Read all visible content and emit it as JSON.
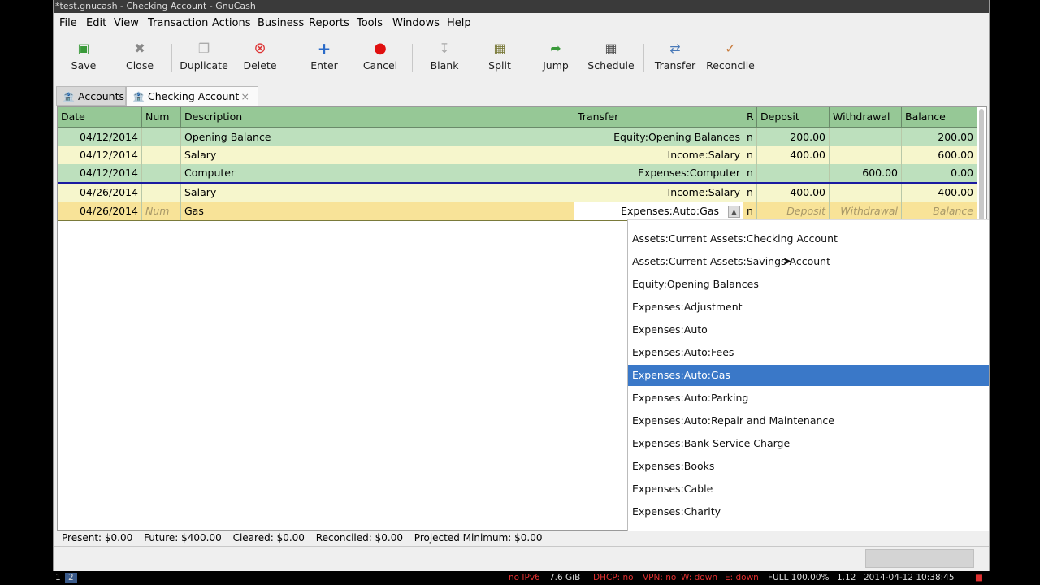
{
  "window": {
    "title": "*test.gnucash - Checking Account - GnuCash"
  },
  "menu": [
    "File",
    "Edit",
    "View",
    "Transaction",
    "Actions",
    "Business",
    "Reports",
    "Tools",
    "Windows",
    "Help"
  ],
  "toolbar": [
    {
      "label": "Save",
      "icon": "save-icon"
    },
    {
      "label": "Close",
      "icon": "close-icon"
    },
    {
      "label": "Duplicate",
      "icon": "duplicate-icon"
    },
    {
      "label": "Delete",
      "icon": "delete-icon"
    },
    {
      "label": "Enter",
      "icon": "enter-icon"
    },
    {
      "label": "Cancel",
      "icon": "cancel-icon"
    },
    {
      "label": "Blank",
      "icon": "blank-icon"
    },
    {
      "label": "Split",
      "icon": "split-icon"
    },
    {
      "label": "Jump",
      "icon": "jump-icon"
    },
    {
      "label": "Schedule",
      "icon": "schedule-icon"
    },
    {
      "label": "Transfer",
      "icon": "transfer-icon"
    },
    {
      "label": "Reconcile",
      "icon": "reconcile-icon"
    }
  ],
  "tabs": [
    {
      "label": "Accounts",
      "icon": "bank-icon"
    },
    {
      "label": "Checking Account",
      "icon": "bank-icon",
      "close": "×"
    }
  ],
  "register": {
    "headers": [
      "Date",
      "Num",
      "Description",
      "Transfer",
      "R",
      "Deposit",
      "Withdrawal",
      "Balance"
    ],
    "rows": [
      {
        "date": "04/12/2014",
        "num": "",
        "desc": "Opening Balance",
        "transfer": "Equity:Opening Balances",
        "r": "n",
        "deposit": "200.00",
        "withdrawal": "",
        "balance": "200.00"
      },
      {
        "date": "04/12/2014",
        "num": "",
        "desc": "Salary",
        "transfer": "Income:Salary",
        "r": "n",
        "deposit": "400.00",
        "withdrawal": "",
        "balance": "600.00"
      },
      {
        "date": "04/12/2014",
        "num": "",
        "desc": "Computer",
        "transfer": "Expenses:Computer",
        "r": "n",
        "deposit": "",
        "withdrawal": "600.00",
        "balance": "0.00"
      },
      {
        "date": "04/26/2014",
        "num": "",
        "desc": "Salary",
        "transfer": "Income:Salary",
        "r": "n",
        "deposit": "400.00",
        "withdrawal": "",
        "balance": "400.00"
      }
    ],
    "edit_row": {
      "date": "04/26/2014",
      "num_placeholder": "Num",
      "desc": "Gas",
      "transfer": "Expenses:Auto:Gas",
      "r": "n",
      "deposit_placeholder": "Deposit",
      "withdrawal_placeholder": "Withdrawal",
      "balance_placeholder": "Balance"
    }
  },
  "dropdown": {
    "items": [
      "Assets:Current Assets:Checking Account",
      "Assets:Current Assets:Savings Account",
      "Equity:Opening Balances",
      "Expenses:Adjustment",
      "Expenses:Auto",
      "Expenses:Auto:Fees",
      "Expenses:Auto:Gas",
      "Expenses:Auto:Parking",
      "Expenses:Auto:Repair and Maintenance",
      "Expenses:Bank Service Charge",
      "Expenses:Books",
      "Expenses:Cable",
      "Expenses:Charity"
    ],
    "selected": "Expenses:Auto:Gas"
  },
  "summary": {
    "present": "Present: $0.00",
    "future": "Future: $400.00",
    "cleared": "Cleared: $0.00",
    "reconciled": "Reconciled: $0.00",
    "projected": "Projected Minimum: $0.00"
  },
  "taskbar": {
    "workspaces": [
      "1",
      "2"
    ],
    "status_ipv6": "no IPv6",
    "status_mem": "7.6 GiB",
    "status_dhcp": "DHCP: no",
    "status_vpn": "VPN: no",
    "status_w": "W: down",
    "status_e": "E: down",
    "status_full": "FULL 100.00%",
    "status_load": "1.12",
    "status_time": "2014-04-12 10:38:45"
  },
  "colors": {
    "header": "#96c896",
    "row_green": "#bde0bd",
    "row_yellow": "#f6f6cc",
    "edit_row": "#f8e398",
    "selection": "#3a78c8"
  }
}
